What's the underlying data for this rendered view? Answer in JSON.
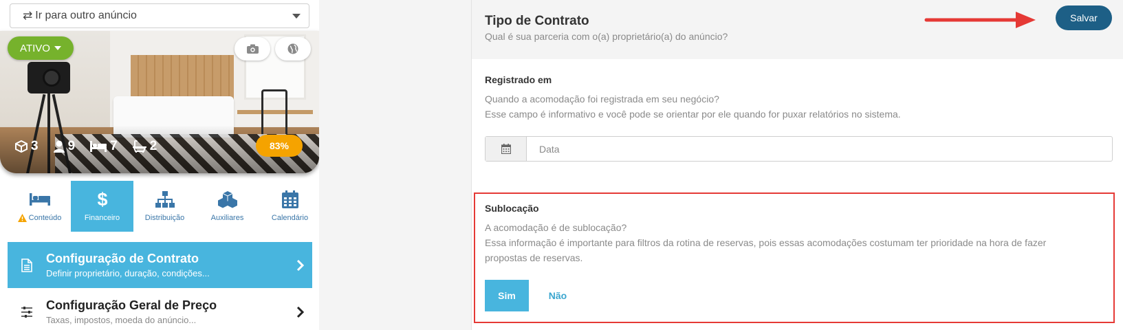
{
  "listing": {
    "goto_label": "Ir para outro anúncio",
    "status_label": "ATIVO",
    "stats": {
      "rooms": "3",
      "guests": "9",
      "beds": "7",
      "baths": "2"
    },
    "completion": "83%"
  },
  "tabs": [
    {
      "label": "Conteúdo",
      "icon": "bed-icon",
      "warning": true
    },
    {
      "label": "Financeiro",
      "icon": "dollar-icon",
      "active": true
    },
    {
      "label": "Distribuição",
      "icon": "sitemap-icon"
    },
    {
      "label": "Auxiliares",
      "icon": "cubes-icon"
    },
    {
      "label": "Calendário",
      "icon": "calendar-icon"
    }
  ],
  "menu": [
    {
      "title": "Configuração de Contrato",
      "subtitle": "Definir proprietário, duração, condições...",
      "icon": "document-icon",
      "active": true
    },
    {
      "title": "Configuração Geral de Preço",
      "subtitle": "Taxas, impostos, moeda do anúncio...",
      "icon": "sliders-icon"
    }
  ],
  "header": {
    "title": "Tipo de Contrato",
    "subtitle": "Qual é sua parceria com o(a) proprietário(a) do anúncio?",
    "save_label": "Salvar"
  },
  "registered": {
    "title": "Registrado em",
    "line1": "Quando a acomodação foi registrada em seu negócio?",
    "line2": "Esse campo é informativo e você pode se orientar por ele quando for puxar relatórios no sistema.",
    "placeholder": "Data"
  },
  "sublease": {
    "title": "Sublocação",
    "line1": "A acomodação é de sublocação?",
    "line2": "Essa informação é importante para filtros da rotina de reservas, pois essas acomodações costumam ter prioridade na hora de fazer",
    "line3": "propostas de reservas.",
    "yes_label": "Sim",
    "no_label": "Não"
  },
  "colors": {
    "primary": "#48b5de",
    "save": "#1d5f86",
    "status_green": "#76b22c",
    "completion_orange": "#f5a300",
    "highlight_red": "#e53935"
  }
}
